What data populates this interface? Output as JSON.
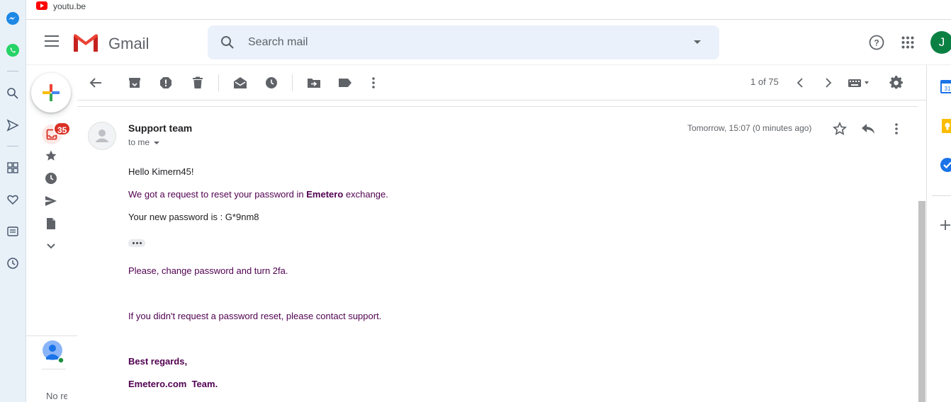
{
  "browser_tab": {
    "label": "youtu.be"
  },
  "header": {
    "app_name": "Gmail",
    "search_placeholder": "Search mail",
    "avatar_initial": "J"
  },
  "nav": {
    "inbox_count": "35",
    "hangouts_text": "No re"
  },
  "toolbar": {
    "page_count": "1 of 75"
  },
  "message": {
    "sender": "Support team",
    "recipient": "to me",
    "date": "Tomorrow, 15:07 (0 minutes ago)",
    "greeting": "Hello Kimern45!",
    "line1_prefix": "We got a request to reset your password in ",
    "line1_brand": "Emetero",
    "line1_suffix": " exchange.",
    "line2": "Your new password is : G*9nm8",
    "line3": "Please, change password and turn 2fa.",
    "line4": "If you didn't request a password reset, please contact support.",
    "signoff": "Best regards,",
    "team": "Emetero.com  Team."
  },
  "colors": {
    "accent_purple": "#500050",
    "badge_red": "#d93025",
    "avatar_green": "#0b8043",
    "search_bg": "#eaf1fb"
  }
}
